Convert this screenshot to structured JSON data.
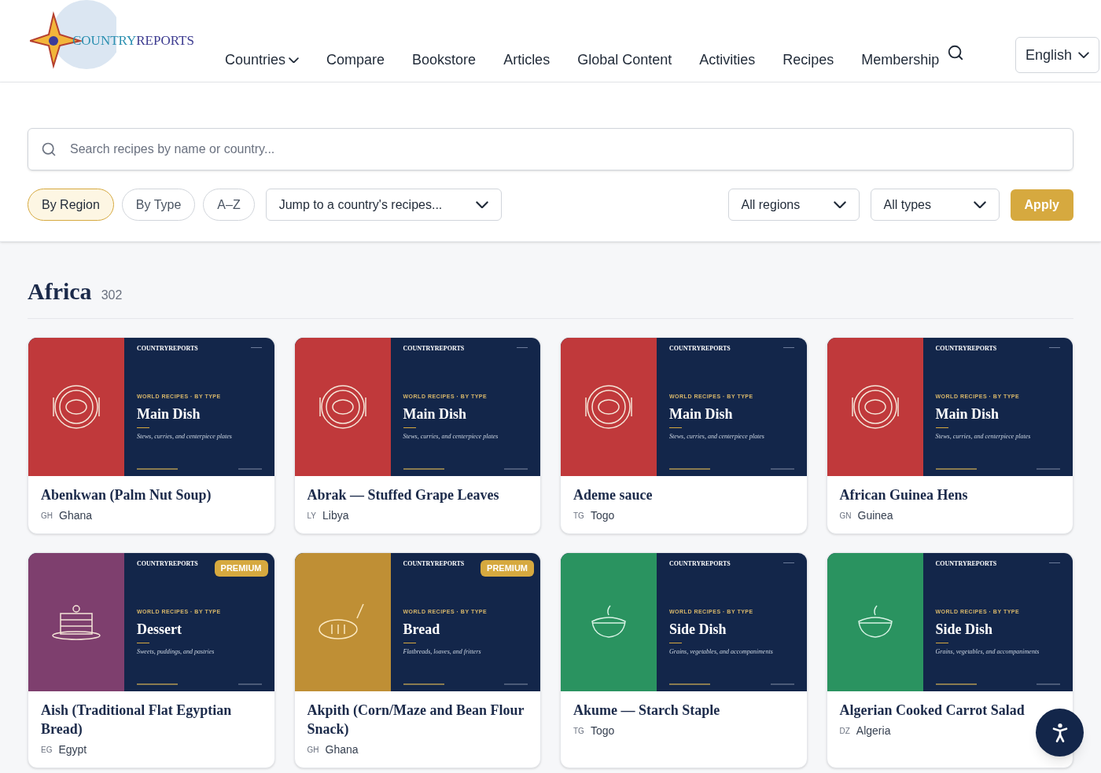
{
  "logo": {
    "part_1": "COUNTRY",
    "part_2": "REPORTS"
  },
  "nav": [
    {
      "label": "Countries",
      "dropdown": true
    },
    {
      "label": "Compare",
      "dropdown": false
    },
    {
      "label": "Bookstore",
      "dropdown": false
    },
    {
      "label": "Articles",
      "dropdown": false
    },
    {
      "label": "Global Content",
      "dropdown": false
    },
    {
      "label": "Activities",
      "dropdown": false
    },
    {
      "label": "Recipes",
      "dropdown": false
    },
    {
      "label": "Membership",
      "dropdown": false
    }
  ],
  "language": "English",
  "search": {
    "placeholder": "Search recipes by name or country..."
  },
  "view_tabs": [
    {
      "label": "By Region",
      "selected": true
    },
    {
      "label": "By Type",
      "selected": false
    },
    {
      "label": "A–Z",
      "selected": false
    }
  ],
  "country_select": "Jump to a country's recipes...",
  "region_select": "All regions",
  "type_select": "All types",
  "apply": "Apply",
  "section": {
    "title": "Africa",
    "count": "302"
  },
  "cards": [
    {
      "title": "Abenkwan (Palm Nut Soup)",
      "code": "GH",
      "country": "Ghana",
      "color": "#c0393b",
      "kind": "plate",
      "image_brand": "COUNTRYREPORTS",
      "image_kicker": "WORLD RECIPES · BY TYPE",
      "image_title": "Main Dish",
      "image_subtitle": "Stews, curries, and centerpiece plates"
    },
    {
      "title": "Abrak — Stuffed Grape Leaves",
      "code": "LY",
      "country": "Libya",
      "color": "#c0393b",
      "kind": "plate",
      "image_brand": "COUNTRYREPORTS",
      "image_kicker": "WORLD RECIPES · BY TYPE",
      "image_title": "Main Dish",
      "image_subtitle": "Stews, curries, and centerpiece plates"
    },
    {
      "title": "Ademe sauce",
      "code": "TG",
      "country": "Togo",
      "color": "#c0393b",
      "kind": "plate",
      "image_brand": "COUNTRYREPORTS",
      "image_kicker": "WORLD RECIPES · BY TYPE",
      "image_title": "Main Dish",
      "image_subtitle": "Stews, curries, and centerpiece plates"
    },
    {
      "title": "African Guinea Hens",
      "code": "GN",
      "country": "Guinea",
      "color": "#c0393b",
      "kind": "plate",
      "image_brand": "COUNTRYREPORTS",
      "image_kicker": "WORLD RECIPES · BY TYPE",
      "image_title": "Main Dish",
      "image_subtitle": "Stews, curries, and centerpiece plates"
    },
    {
      "title": "Aish (Traditional Flat Egyptian Bread)",
      "code": "EG",
      "country": "Egypt",
      "color": "#7e3f6e",
      "kind": "cake",
      "badge": "PREMIUM",
      "image_brand": "COUNTRYREPORTS",
      "image_kicker": "WORLD RECIPES · BY TYPE",
      "image_title": "Dessert",
      "image_subtitle": "Sweets, puddings, and pastries"
    },
    {
      "title": "Akpith (Corn/Maze and Bean Flour Snack)",
      "code": "GH",
      "country": "Ghana",
      "color": "#bf8f35",
      "kind": "bread",
      "badge": "PREMIUM",
      "image_brand": "COUNTRYREPORTS",
      "image_kicker": "WORLD RECIPES · BY TYPE",
      "image_title": "Bread",
      "image_subtitle": "Flatbreads, loaves, and fritters"
    },
    {
      "title": "Akume — Starch Staple",
      "code": "TG",
      "country": "Togo",
      "color": "#2a9360",
      "kind": "bowl",
      "image_brand": "COUNTRYREPORTS",
      "image_kicker": "WORLD RECIPES · BY TYPE",
      "image_title": "Side Dish",
      "image_subtitle": "Grains, vegetables, and accompaniments"
    },
    {
      "title": "Algerian Cooked Carrot Salad",
      "code": "DZ",
      "country": "Algeria",
      "color": "#2a9360",
      "kind": "bowl",
      "image_brand": "COUNTRYREPORTS",
      "image_kicker": "WORLD RECIPES · BY TYPE",
      "image_title": "Side Dish",
      "image_subtitle": "Grains, vegetables, and accompaniments"
    }
  ]
}
